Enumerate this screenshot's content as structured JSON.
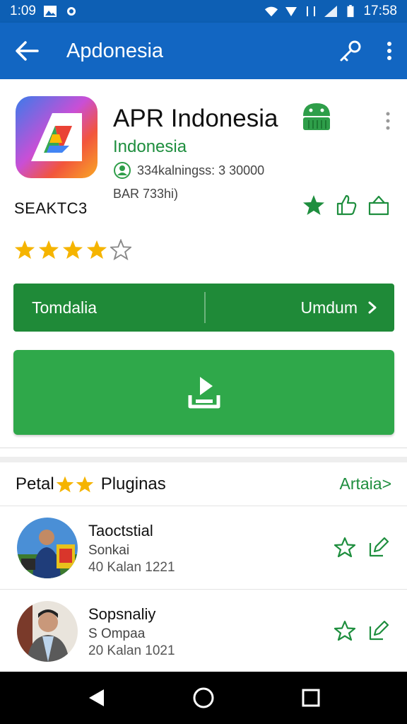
{
  "status_bar": {
    "time_left": "1:09",
    "time_right": "17:58"
  },
  "app_bar": {
    "title": "Apdonesia"
  },
  "app": {
    "name": "APR Indonesia",
    "developer": "Indonesia",
    "downloads": "334kalningss: 3 30000",
    "size": "BAR 733hi)",
    "code": "SEAKTC3",
    "rating_stars": 4,
    "rating_max": 5
  },
  "split_button": {
    "left_label": "Tomdalia",
    "right_label": "Umdum"
  },
  "section": {
    "title_prefix": "Petal",
    "title_suffix": "Pluginas",
    "link": "Artaia>"
  },
  "items": [
    {
      "name": "Taoctstial",
      "sub": "Sonkai",
      "meta": "40 Kalan 1221"
    },
    {
      "name": "Sopsnaliy",
      "sub": "S Ompaa",
      "meta": "20 Kalan 1021"
    }
  ],
  "colors": {
    "appbar": "#1266c2",
    "statusbar": "#0d5fb4",
    "green_dark": "#1f8a38",
    "green_main": "#2fa84a",
    "green_text": "#1e8e3e",
    "star": "#f5b400"
  }
}
